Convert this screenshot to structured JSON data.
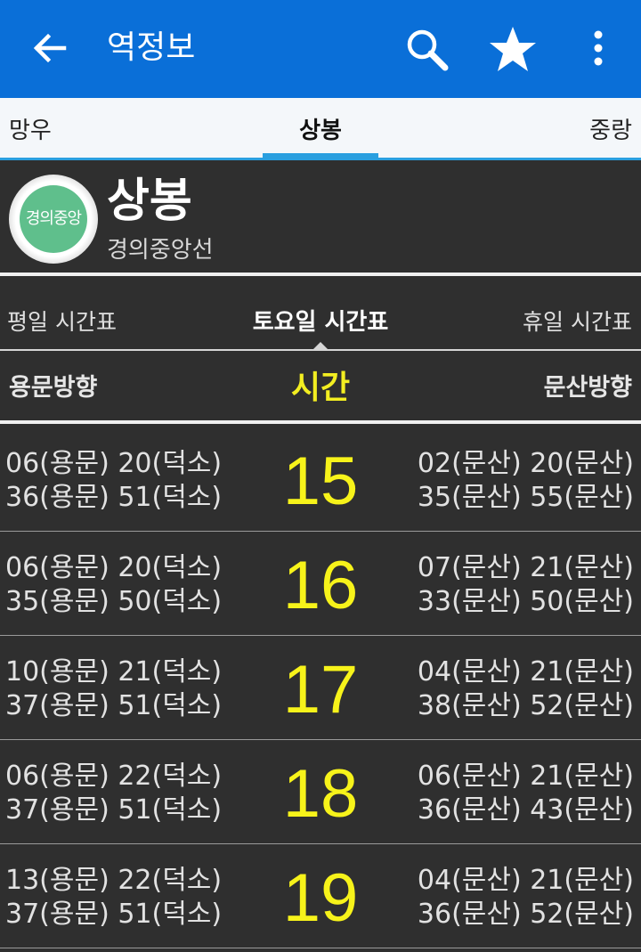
{
  "appbar": {
    "title": "역정보",
    "back_icon": "arrow-left-icon",
    "search_icon": "search-icon",
    "favorite_icon": "star-icon",
    "more_icon": "more-vert-icon",
    "color": "#0a6fd8"
  },
  "station_tabs": {
    "prev": "망우",
    "current": "상봉",
    "next": "중랑"
  },
  "station": {
    "name": "상봉",
    "line": "경의중앙선",
    "badge_text": "경의중앙",
    "badge_color": "#5fbf8c"
  },
  "day_tabs": {
    "weekday": "평일 시간표",
    "saturday": "토요일 시간표",
    "holiday": "휴일 시간표"
  },
  "columns": {
    "left": "용문방향",
    "middle": "시간",
    "right": "문산방향"
  },
  "schedule": [
    {
      "hour": "15",
      "left": [
        "06(용문) 20(덕소)",
        "36(용문) 51(덕소)"
      ],
      "right": [
        "02(문산) 20(문산)",
        "35(문산) 55(문산)"
      ]
    },
    {
      "hour": "16",
      "left": [
        "06(용문) 20(덕소)",
        "35(용문) 50(덕소)"
      ],
      "right": [
        "07(문산) 21(문산)",
        "33(문산) 50(문산)"
      ]
    },
    {
      "hour": "17",
      "left": [
        "10(용문) 21(덕소)",
        "37(용문) 51(덕소)"
      ],
      "right": [
        "04(문산) 21(문산)",
        "38(문산) 52(문산)"
      ]
    },
    {
      "hour": "18",
      "left": [
        "06(용문) 22(덕소)",
        "37(용문) 51(덕소)"
      ],
      "right": [
        "06(문산) 21(문산)",
        "36(문산) 43(문산)"
      ]
    },
    {
      "hour": "19",
      "left": [
        "13(용문) 22(덕소)",
        "37(용문) 51(덕소)"
      ],
      "right": [
        "04(문산) 21(문산)",
        "36(문산) 52(문산)"
      ]
    }
  ]
}
